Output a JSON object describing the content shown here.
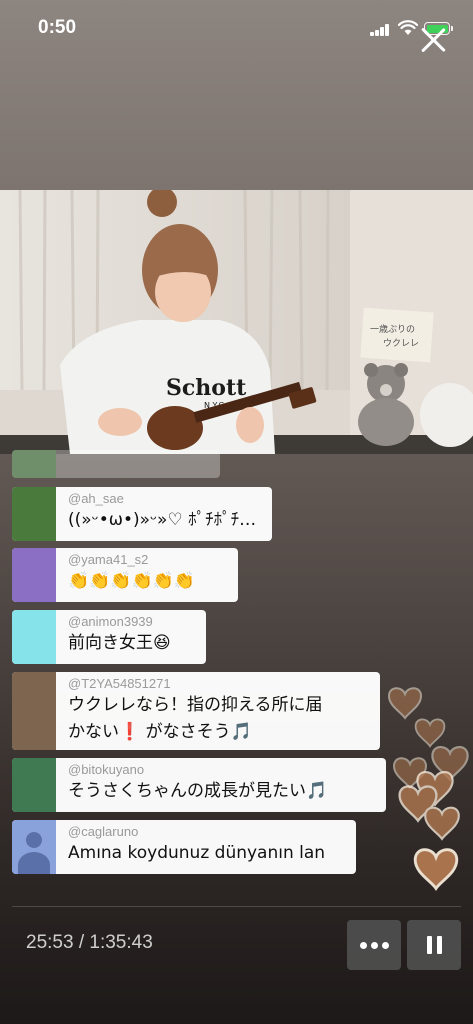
{
  "status_bar": {
    "time": "0:50"
  },
  "player": {
    "position": "25:53",
    "separator": " / ",
    "duration": "1:35:43"
  },
  "video": {
    "shirt_brand": "Schott",
    "shirt_sub": "N.Y.C."
  },
  "chat": {
    "messages": [
      {
        "handle": "@ah_sae",
        "text": "((»ᵕ•ω•)»ᵕ»♡ ﾎﾟﾁﾎﾟﾁ…",
        "avatar_color": "#4a7a3c"
      },
      {
        "handle": "@yama41_s2",
        "text": "👏👏👏👏👏👏",
        "avatar_color": "#8a6fc4"
      },
      {
        "handle": "@animon3939",
        "text": "前向き女王😆",
        "avatar_color": "#86e3ea"
      },
      {
        "handle": "@T2YA54851271",
        "text_line1": "ウクレレなら！指の抑える所に届",
        "text_line2": "かない❗️ がなさそう🎵",
        "avatar_color": "#7d6550"
      },
      {
        "handle": "@bitokuyano",
        "text": "そうさくちゃんの成長が見たい🎵",
        "avatar_color": "#3f7a52"
      },
      {
        "handle": "@caglaruno",
        "text": "Amına koydunuz dünyanın lan",
        "avatar_color": "#8aa2dc"
      }
    ]
  },
  "colors": {
    "battery": "#3fd15a",
    "heart_fill": "#b07850"
  }
}
